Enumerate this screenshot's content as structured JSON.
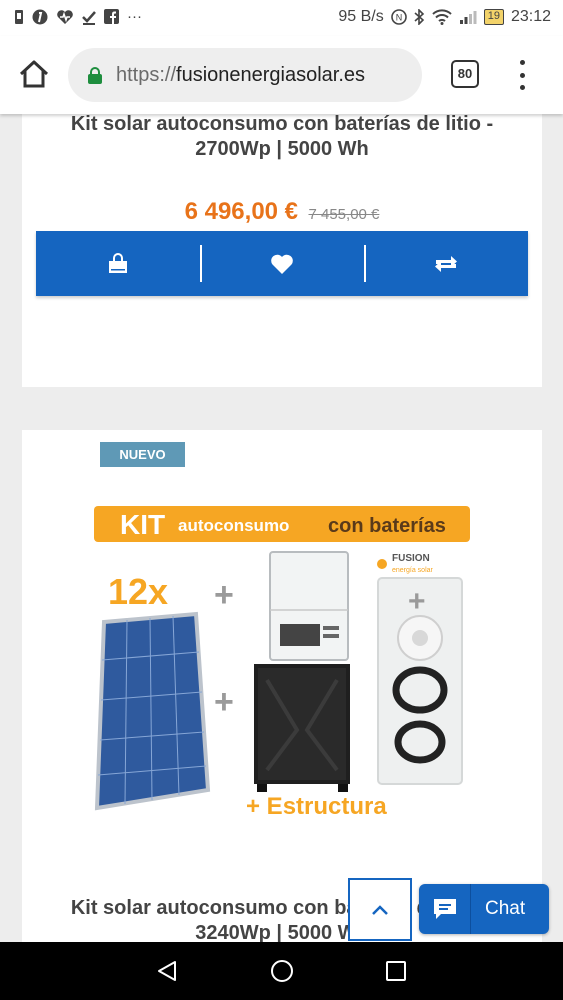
{
  "status_bar": {
    "left_icons": [
      "notification-icon",
      "pinterest-icon",
      "health-icon",
      "download-done-icon",
      "facebook-icon",
      "more-icon"
    ],
    "more_text": "···",
    "net_speed": "95 B/s",
    "battery": "19",
    "time": "23:12"
  },
  "browser": {
    "url_scheme": "https://",
    "url_host": "fusionenergiasolar.es",
    "tab_count": "80"
  },
  "products": [
    {
      "title": "Kit solar autoconsumo con baterías de litio - 2700Wp | 5000 Wh",
      "price": "6 496,00 €",
      "old_price": "7 455,00 €"
    },
    {
      "badge": "NUEVO",
      "title": "Kit solar autoconsumo con baterías de litio - 3240Wp | 5000 Wh",
      "image": {
        "banner_kit": "KIT",
        "banner_mid": "autoconsumo",
        "banner_end": "con baterías",
        "panel_count": "12x",
        "plus": "+",
        "structure": "+ Estructura",
        "brand_top": "FUSION",
        "brand_bottom": "energía solar"
      }
    }
  ],
  "widgets": {
    "chat_label": "Chat"
  },
  "colors": {
    "accent_blue": "#1565c0",
    "price_orange": "#e8731a",
    "badge_blue": "#5f99b6",
    "secure_green": "#1e8e3e"
  }
}
